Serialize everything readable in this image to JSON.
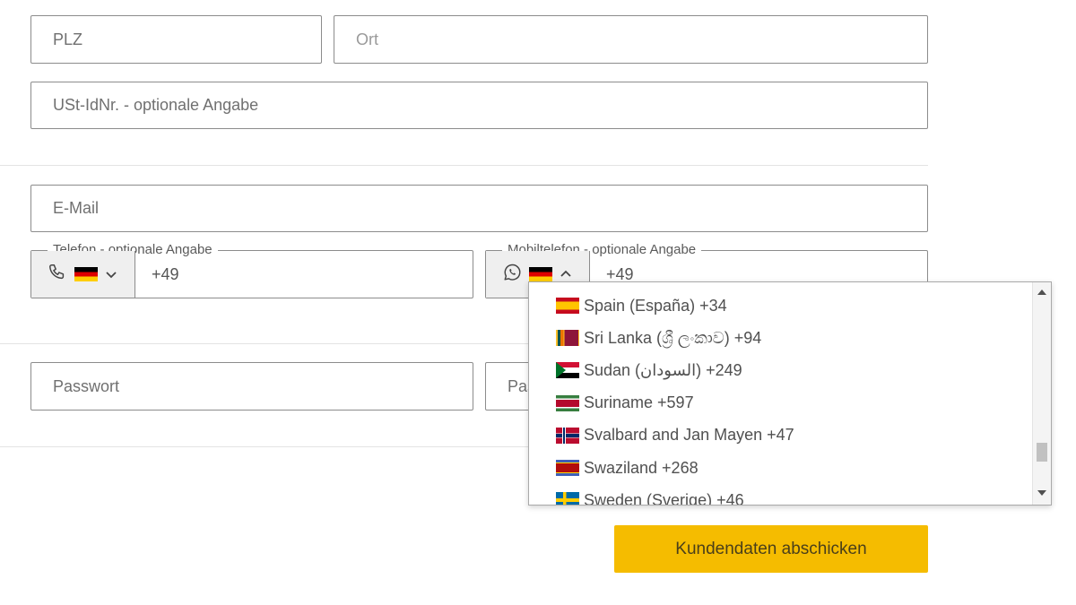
{
  "form": {
    "plz": {
      "placeholder": "PLZ"
    },
    "ort": {
      "placeholder": "Ort"
    },
    "ust": {
      "placeholder": "USt-IdNr. - optionale Angabe"
    },
    "email": {
      "placeholder": "E-Mail"
    },
    "telefon": {
      "label": "Telefon - optionale Angabe",
      "icon": "phone-icon",
      "country_flag": "germany-flag",
      "value": "+49"
    },
    "mobil": {
      "label": "Mobiltelefon - optionale Angabe",
      "icon": "whatsapp-icon",
      "country_flag": "germany-flag",
      "value": "+49"
    },
    "passwort": {
      "placeholder": "Passwort"
    },
    "passwort_confirm": {
      "placeholder": "Pas"
    },
    "submit_label": "Kundendaten abschicken"
  },
  "country_dropdown": {
    "items": [
      {
        "label": "Spain (España) +34",
        "flag": "spain-flag"
      },
      {
        "label": "Sri Lanka (ශ්‍රී ලංකාව) +94",
        "flag": "sri-lanka-flag"
      },
      {
        "label": "Sudan (‫السودان‬‎) +249",
        "flag": "sudan-flag"
      },
      {
        "label": "Suriname +597",
        "flag": "suriname-flag"
      },
      {
        "label": "Svalbard and Jan Mayen +47",
        "flag": "norway-flag"
      },
      {
        "label": "Swaziland +268",
        "flag": "swaziland-flag"
      },
      {
        "label": "Sweden (Sverige) +46",
        "flag": "sweden-flag"
      }
    ]
  },
  "colors": {
    "accent": "#f5bc00",
    "border": "#8c8c8c",
    "prefix_bg": "#efefef"
  }
}
